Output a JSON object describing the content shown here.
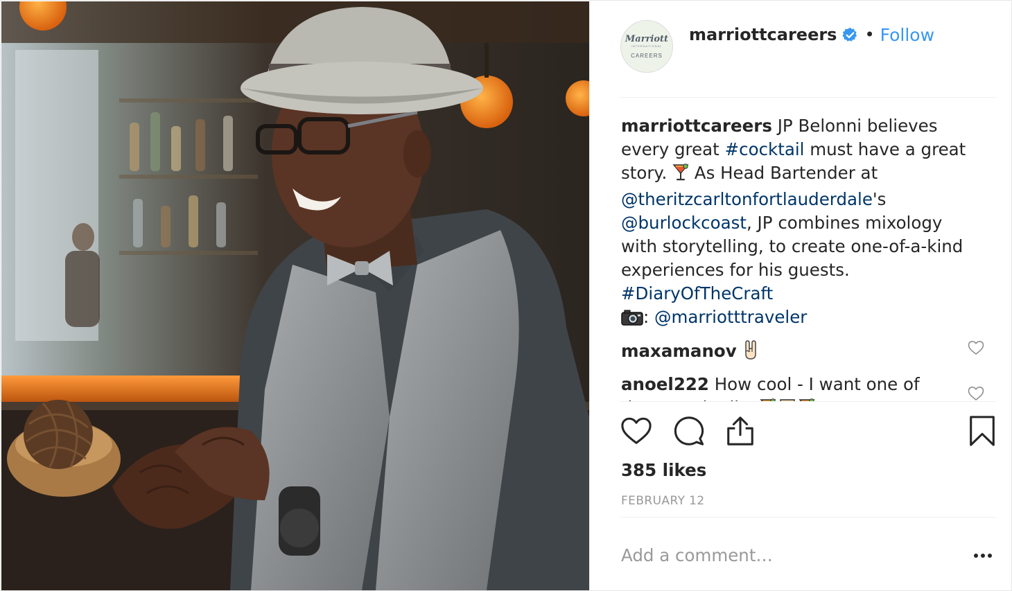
{
  "post": {
    "image_alt": "Smiling bartender wearing a gray fedora, glasses, bow tie and vest, seated at a bar"
  },
  "header": {
    "avatar_brand": "Marriott",
    "avatar_brand_sub": "INTERNATIONAL",
    "avatar_careers": "CAREERS",
    "username": "marriottcareers",
    "separator": "•",
    "follow_label": "Follow"
  },
  "caption": {
    "username": "marriottcareers",
    "t1": " JP Belonni believes every great ",
    "hashtag1": "#cocktail",
    "t2": " must have a great story. ",
    "t3": " As Head Bartender at ",
    "mention1": "@theritzcarltonfortlauderdale",
    "t4": "'s ",
    "mention2": "@burlockcoast",
    "t5": ", JP combines mixology with storytelling, to create one-of-a-kind experiences for his guests. ",
    "hashtag2": "#DiaryOfTheCraft",
    "t6": ": ",
    "mention3": "@marriotttraveler"
  },
  "comments": [
    {
      "username": "maxamanov",
      "text": " "
    },
    {
      "username": "anoel222",
      "text": " How cool - I want one of those cocktails! "
    }
  ],
  "actions": {
    "likes": "385 likes",
    "date": "FEBRUARY 12"
  },
  "add_comment": {
    "placeholder": "Add a comment…"
  },
  "icons": [
    "verified-badge-icon",
    "like-heart-icon",
    "comment-bubble-icon",
    "share-icon",
    "bookmark-icon",
    "more-options-icon",
    "comment-like-icon",
    "cocktail-emoji-icon",
    "camera-emoji-icon",
    "rock-hand-emoji-icon",
    "tumbler-emoji-icon"
  ],
  "colors": {
    "link": "#003569",
    "follow": "#3897f0",
    "verified": "#3897f0",
    "muted": "#999999",
    "text": "#262626"
  }
}
